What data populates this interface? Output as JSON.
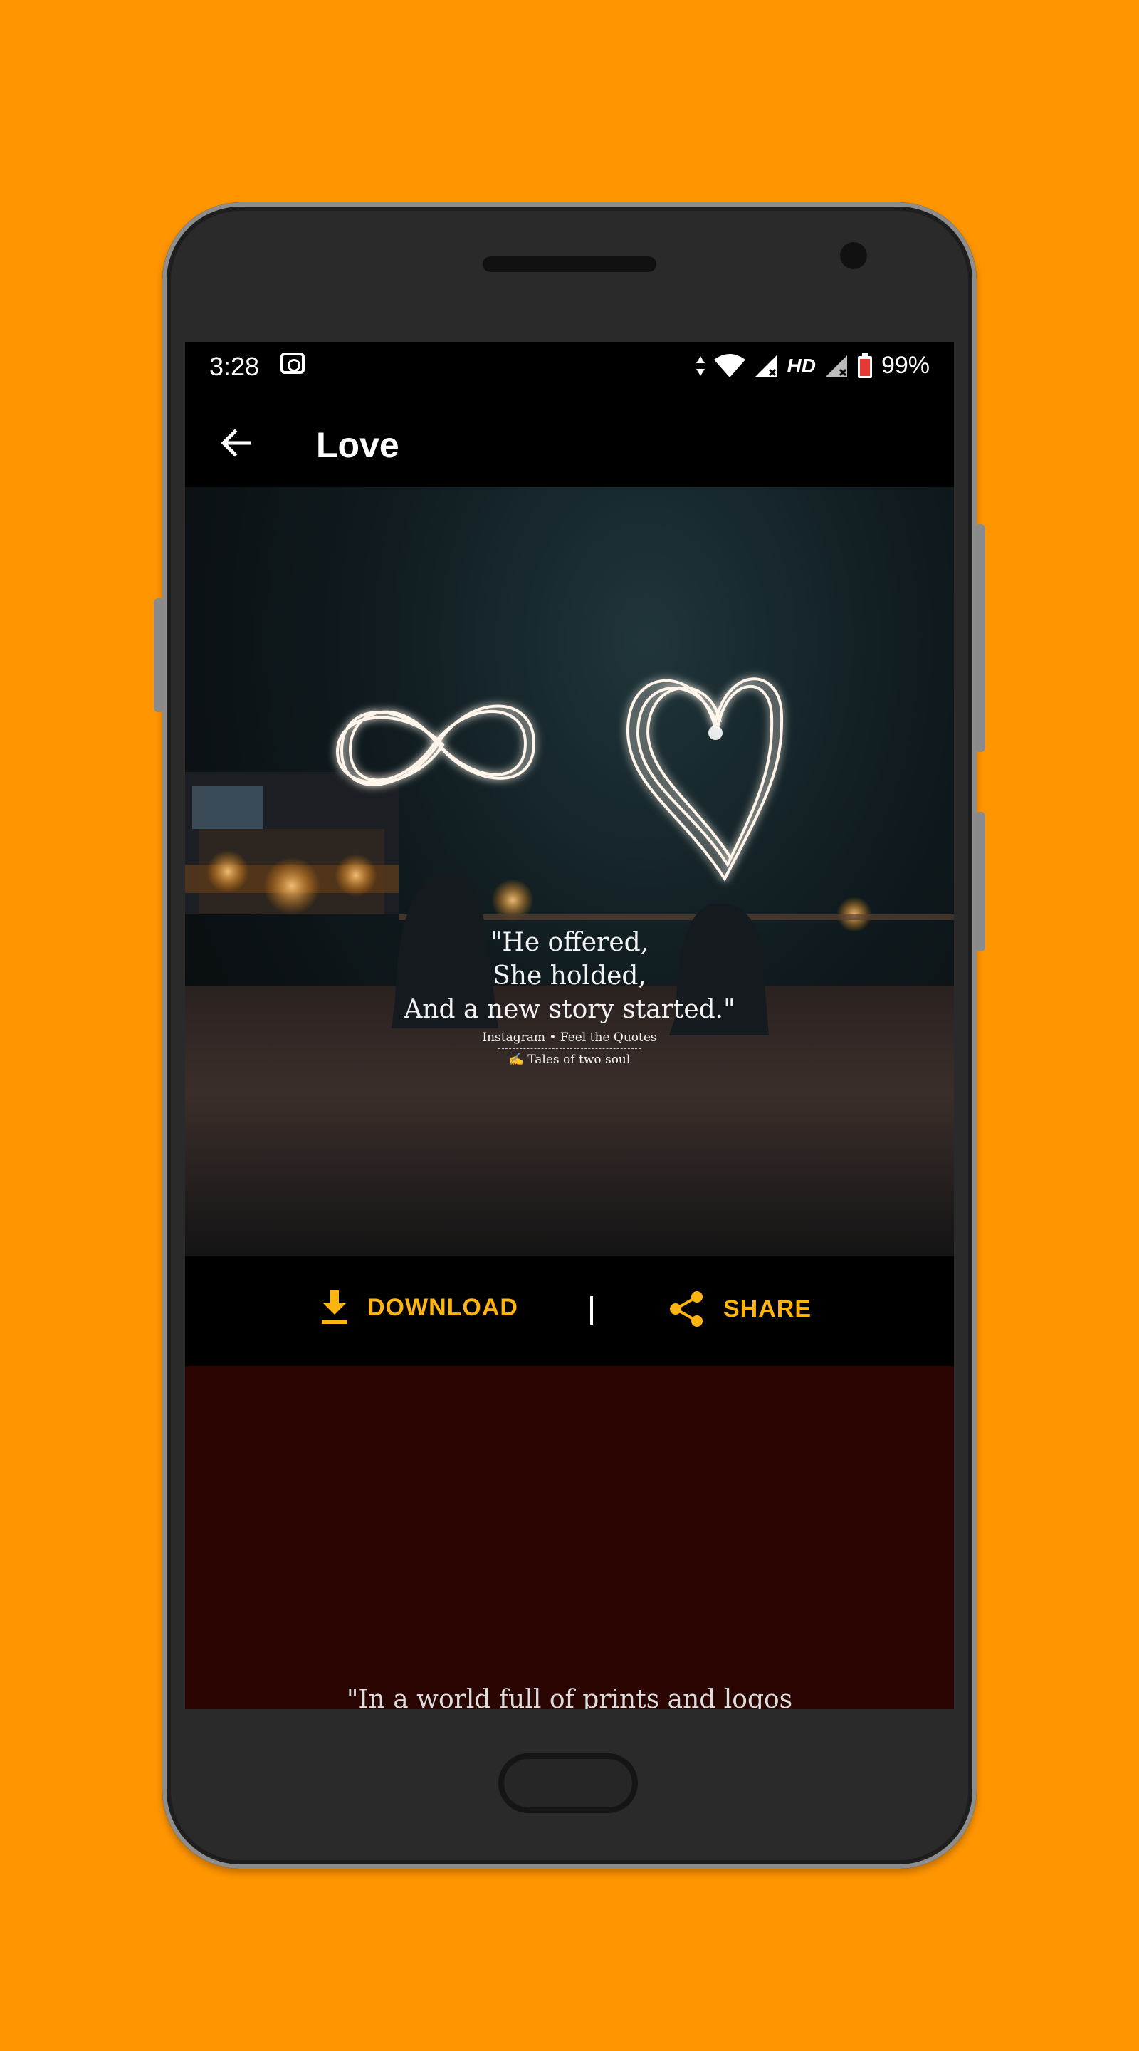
{
  "colors": {
    "background": "#FF9500",
    "accent": "#FFB40F",
    "next_card": "#2a0501"
  },
  "status_bar": {
    "time": "3:28",
    "network": "HD",
    "battery": "99%",
    "icons": [
      "vault-icon",
      "data-arrows-icon",
      "wifi-icon",
      "signal-icon",
      "signal-icon-2",
      "battery-icon"
    ]
  },
  "app_bar": {
    "back_icon": "arrow-left-icon",
    "title": "Love"
  },
  "quote_card": {
    "lines": [
      "\"He offered,",
      "She holded,",
      "And a new story started.\""
    ],
    "credit": "Instagram  •  Feel the Quotes",
    "signature": "✍ Tales of two soul"
  },
  "actions": {
    "download_label": "DOWNLOAD",
    "download_icon": "download-icon",
    "share_label": "SHARE",
    "share_icon": "share-icon"
  },
  "next_card": {
    "partial_text": "\"In a world full of prints and logos"
  }
}
